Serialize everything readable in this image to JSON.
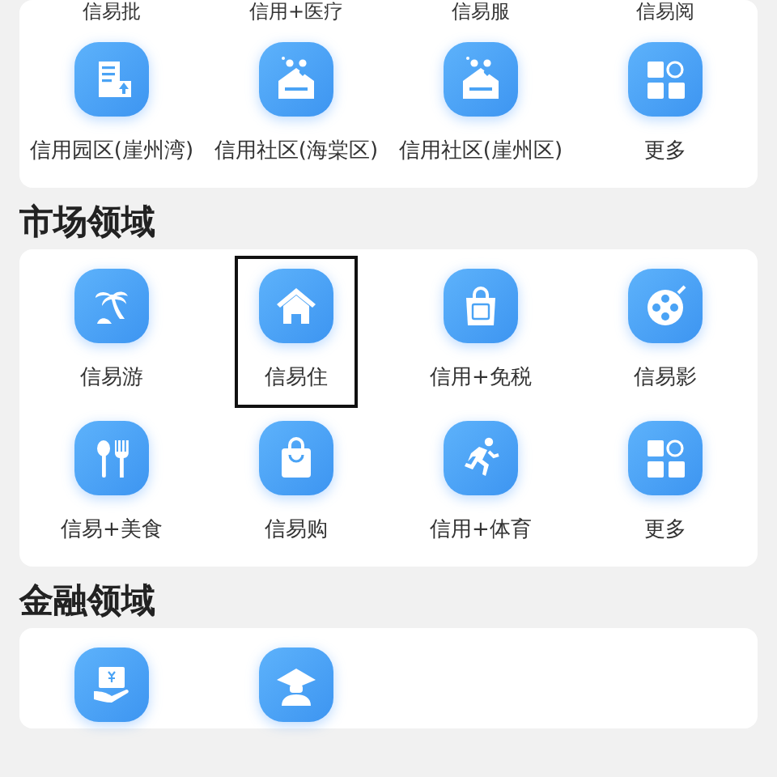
{
  "partial_section": {
    "cut_labels": [
      "信易批",
      "信用+医疗",
      "信易服",
      "信易阅"
    ],
    "items": [
      {
        "label": "信用园区(崖州湾)",
        "selected": false
      },
      {
        "label": "信用社区(海棠区)",
        "selected": false
      },
      {
        "label": "信用社区(崖州区)",
        "selected": false
      },
      {
        "label": "更多",
        "selected": false
      }
    ]
  },
  "sections": [
    {
      "title": "市场领域",
      "items": [
        {
          "label": "信易游",
          "selected": false
        },
        {
          "label": "信易住",
          "selected": true
        },
        {
          "label": "信用+免税",
          "selected": false
        },
        {
          "label": "信易影",
          "selected": false
        },
        {
          "label": "信易+美食",
          "selected": false
        },
        {
          "label": "信易购",
          "selected": false
        },
        {
          "label": "信用+体育",
          "selected": false
        },
        {
          "label": "更多",
          "selected": false
        }
      ]
    },
    {
      "title": "金融领域",
      "items": [
        {
          "selected": false
        },
        {
          "selected": false
        }
      ]
    }
  ]
}
